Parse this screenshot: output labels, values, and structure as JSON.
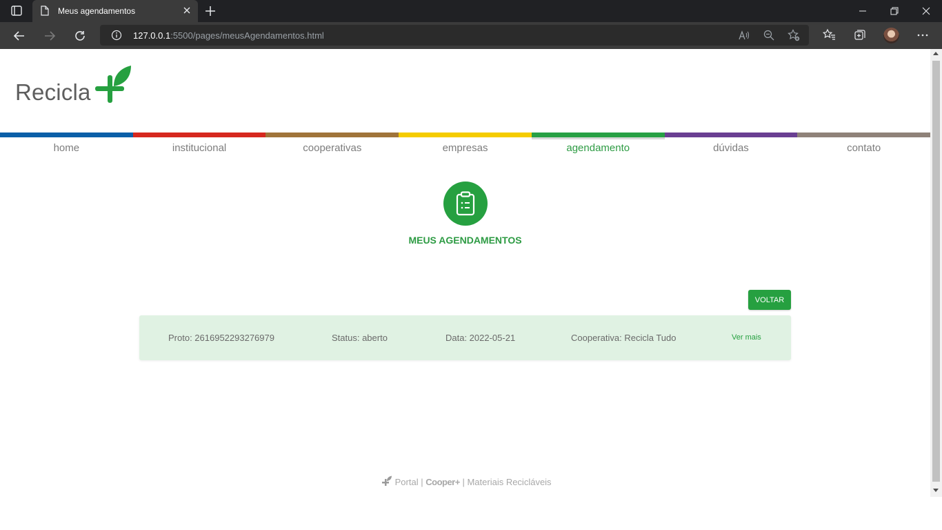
{
  "browser": {
    "tab_title": "Meus agendamentos",
    "url_host": "127.0.0.1",
    "url_rest": ":5500/pages/meusAgendamentos.html"
  },
  "site": {
    "logo_text": "Recicla",
    "menu": [
      {
        "label": "home",
        "color": "#0b5fa8"
      },
      {
        "label": "institucional",
        "color": "#d6281e"
      },
      {
        "label": "cooperativas",
        "color": "#a0743a"
      },
      {
        "label": "empresas",
        "color": "#f5cc00"
      },
      {
        "label": "agendamento",
        "color": "#27a044",
        "active": true
      },
      {
        "label": "dúvidas",
        "color": "#6a3f92"
      },
      {
        "label": "contato",
        "color": "#8f8279"
      }
    ],
    "accent_color": "#26a040"
  },
  "main": {
    "title": "MEUS AGENDAMENTOS",
    "back_button": "VOLTAR",
    "appointments": [
      {
        "protocol": "Proto: 2616952293276979",
        "status": "Status: aberto",
        "date": "Data: 2022-05-21",
        "cooperative": "Cooperativa: Recicla Tudo",
        "details_link": "Ver mais"
      }
    ]
  },
  "footer": {
    "portal": "Portal",
    "brand": "Cooper+",
    "subtitle": "Materiais Recicláveis",
    "separator": "|"
  }
}
